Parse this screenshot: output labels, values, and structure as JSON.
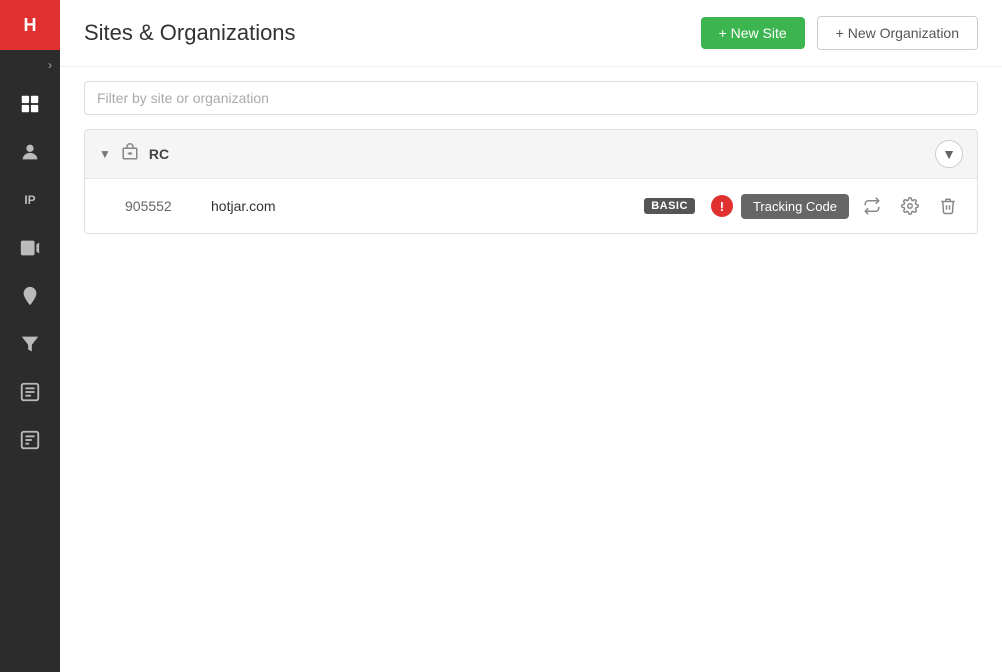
{
  "sidebar": {
    "logo_text": "H",
    "toggle_icon": "›",
    "items": [
      {
        "name": "dashboard",
        "icon": "dashboard"
      },
      {
        "name": "users",
        "icon": "person"
      },
      {
        "name": "ip",
        "label": "IP",
        "text": true
      },
      {
        "name": "recordings",
        "icon": "play"
      },
      {
        "name": "heatmaps",
        "icon": "flame"
      },
      {
        "name": "funnels",
        "icon": "funnel"
      },
      {
        "name": "forms",
        "icon": "form"
      },
      {
        "name": "reports",
        "icon": "reports"
      }
    ]
  },
  "header": {
    "title": "Sites & Organizations",
    "btn_new_site_label": "+ New Site",
    "btn_new_org_label": "+ New Organization"
  },
  "filter": {
    "placeholder": "Filter by site or organization",
    "value": ""
  },
  "organizations": [
    {
      "name": "RC",
      "sites": [
        {
          "id": "905552",
          "domain": "hotjar.com",
          "plan": "BASIC",
          "has_warning": true,
          "tracking_code_label": "Tracking Code"
        }
      ]
    }
  ]
}
